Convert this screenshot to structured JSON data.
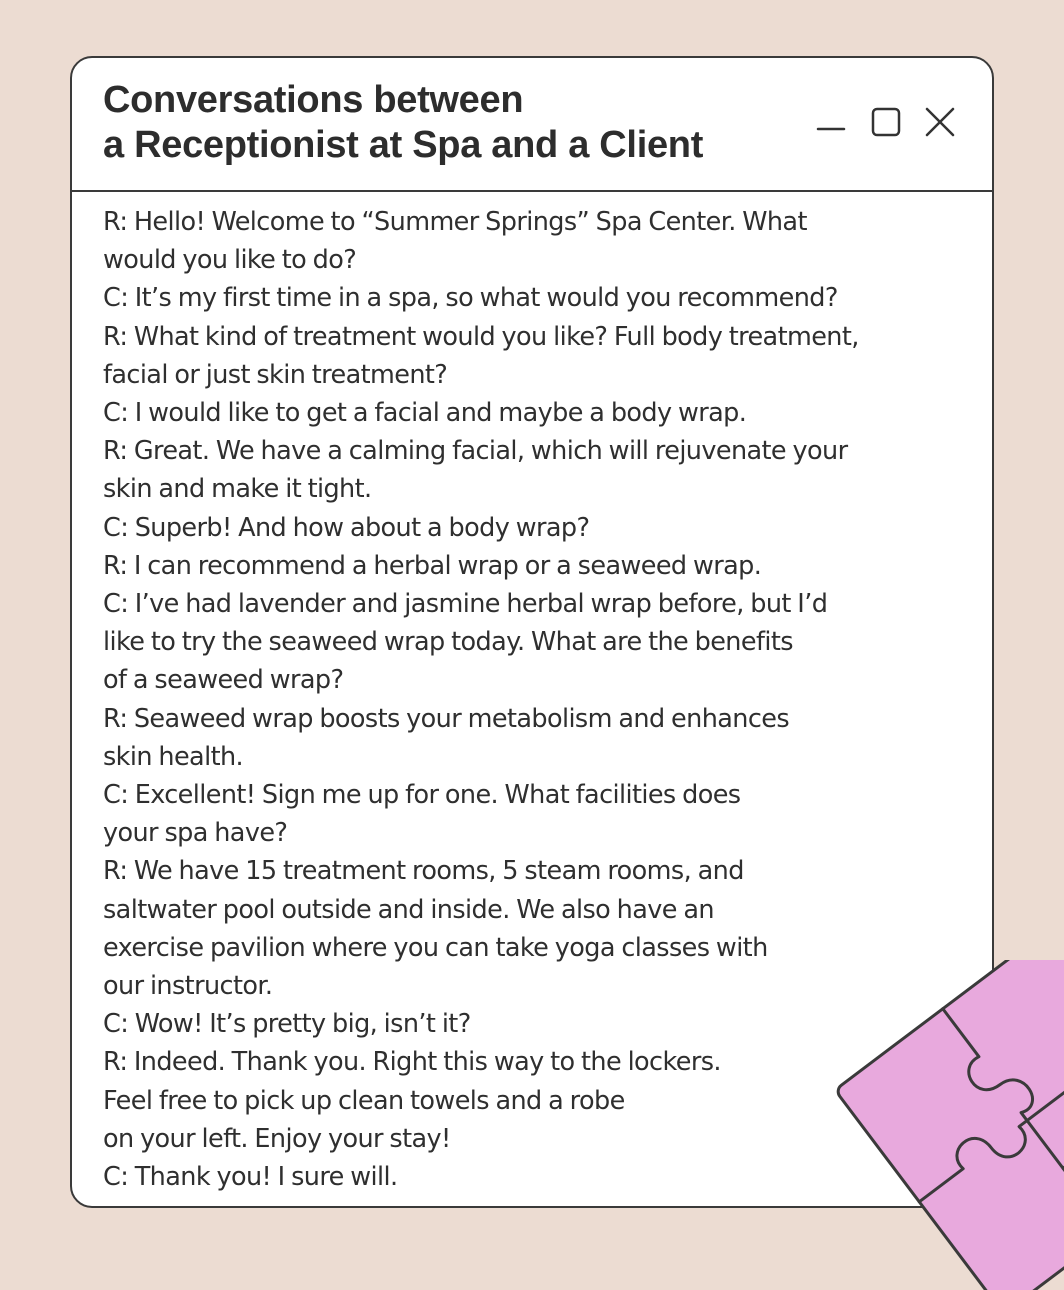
{
  "window": {
    "title_lines": [
      "Conversations between",
      "a Receptionist at Spa and a Client"
    ],
    "controls": {
      "minimize_icon": "minimize-icon",
      "maximize_icon": "maximize-icon",
      "close_icon": "close-icon"
    }
  },
  "dialogue_lines": [
    "R: Hello! Welcome to “Summer Springs” Spa Center. What",
    "would you like to do?",
    "C: It’s my first time in a spa, so what would you recommend?",
    "R: What kind of treatment would you like? Full body treatment,",
    "facial or just skin treatment?",
    "C: I would like to get a facial and maybe a body wrap.",
    "R: Great. We have a calming facial, which will rejuvenate your",
    "skin and make it tight.",
    "C: Superb! And how about a body wrap?",
    "R: I can recommend a herbal wrap or a seaweed wrap.",
    "C: I’ve had lavender and jasmine herbal wrap before, but I’d",
    "like to try the seaweed wrap today. What are the benefits",
    "of a seaweed wrap?",
    "R: Seaweed wrap boosts your metabolism and enhances",
    "skin health.",
    "C: Excellent! Sign me up for one. What facilities does",
    "your spa have?",
    "R: We have 15 treatment rooms, 5 steam rooms, and",
    "saltwater pool outside and inside. We also have an",
    "exercise pavilion where you can take yoga classes with",
    "our instructor.",
    "C: Wow! It’s pretty big, isn’t it?",
    "R: Indeed. Thank you. Right this way to the lockers.",
    "Feel free to pick up clean towels and a robe",
    "on your left. Enjoy your stay!",
    "C: Thank you! I sure will."
  ],
  "colors": {
    "background": "#ecdcd2",
    "window": "#ffffff",
    "border": "#3a3a3a",
    "puzzle": "#e8a9dd"
  },
  "decoration": "puzzle-icon"
}
